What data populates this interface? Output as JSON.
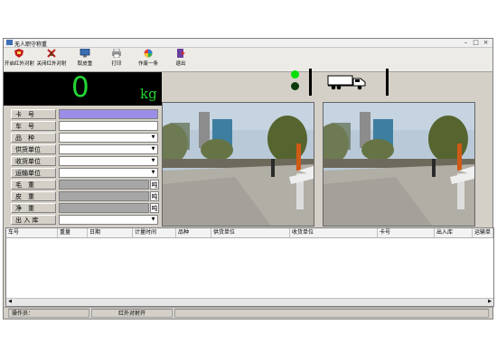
{
  "window": {
    "title": "无人职守称重"
  },
  "toolbar": {
    "buttons": [
      {
        "label": "开启红外对射",
        "icon": "red-shield-icon"
      },
      {
        "label": "关闭红外对射",
        "icon": "red-cross-icon"
      },
      {
        "label": "取皮重",
        "icon": "monitor-icon"
      },
      {
        "label": "打印",
        "icon": "printer-icon"
      },
      {
        "label": "作废一条",
        "icon": "color-wheel-icon"
      },
      {
        "label": "退出",
        "icon": "exit-door-icon"
      }
    ]
  },
  "scale": {
    "weight": "0",
    "unit": "kg"
  },
  "indicators": {
    "light_top": "#00e000",
    "light_bottom": "#0b3b0b"
  },
  "form": {
    "fields": [
      {
        "label": "卡　号",
        "value": "",
        "type": "card"
      },
      {
        "label": "车　号",
        "value": "",
        "type": "text"
      },
      {
        "label": "品　种",
        "value": "",
        "type": "select"
      },
      {
        "label": "供货单位",
        "value": "",
        "type": "select"
      },
      {
        "label": "收货单位",
        "value": "",
        "type": "select"
      },
      {
        "label": "运输单位",
        "value": "",
        "type": "select"
      },
      {
        "label": "毛　重",
        "value": "",
        "type": "weight",
        "unit": "吨"
      },
      {
        "label": "皮　重",
        "value": "",
        "type": "weight",
        "unit": "吨"
      },
      {
        "label": "净　重",
        "value": "",
        "type": "weight",
        "unit": "吨"
      },
      {
        "label": "出 入 库",
        "value": "",
        "type": "select"
      }
    ]
  },
  "table": {
    "columns": [
      "车号",
      "重量",
      "日期",
      "计量时间",
      "品种",
      "供货单位",
      "收货单位",
      "卡号",
      "出入库",
      "运输单"
    ]
  },
  "status": {
    "operator_label": "操作员：",
    "operator_value": "",
    "ir_status": "红外对射开"
  }
}
